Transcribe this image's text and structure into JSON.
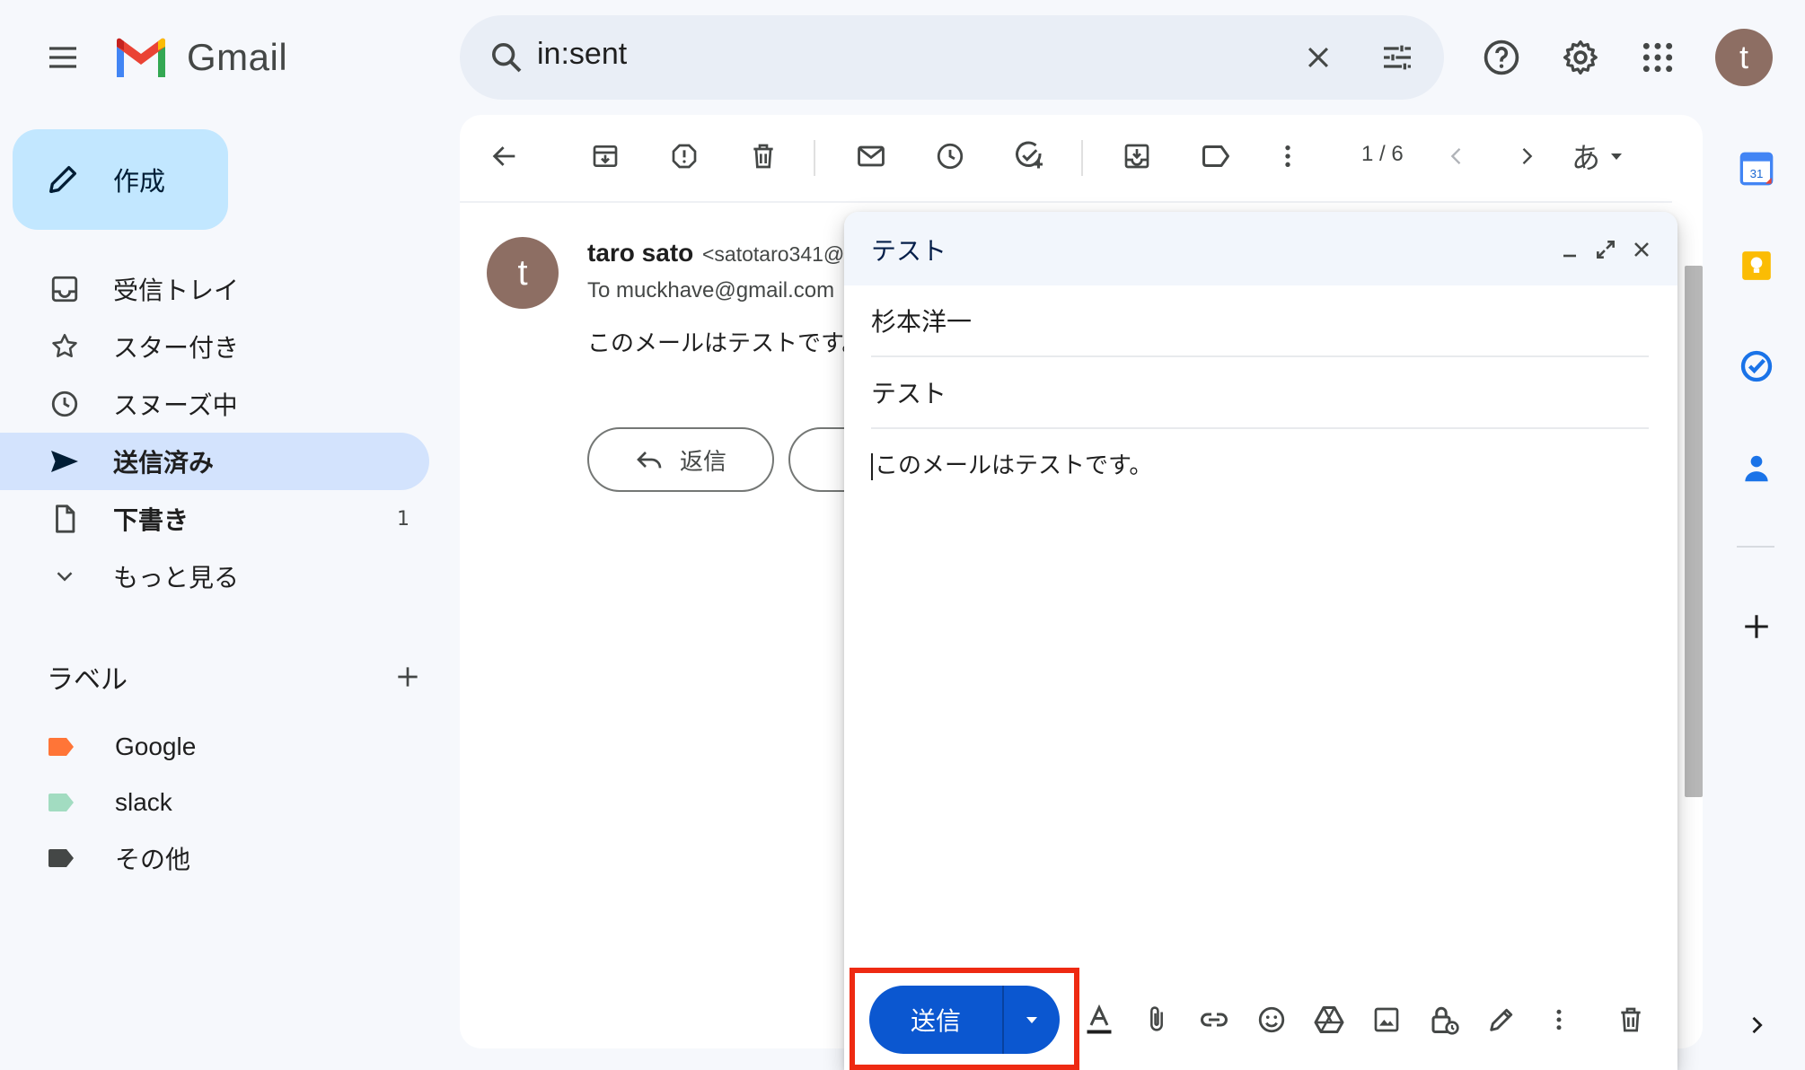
{
  "header": {
    "app_name": "Gmail",
    "search_value": "in:sent"
  },
  "sidebar": {
    "compose_label": "作成",
    "items": [
      {
        "label": "受信トレイ",
        "icon": "inbox-icon"
      },
      {
        "label": "スター付き",
        "icon": "star-icon"
      },
      {
        "label": "スヌーズ中",
        "icon": "clock-icon"
      },
      {
        "label": "送信済み",
        "icon": "send-icon",
        "active": true
      },
      {
        "label": "下書き",
        "icon": "draft-icon",
        "count": "1"
      },
      {
        "label": "もっと見る",
        "icon": "chevron-down-icon"
      }
    ],
    "labels_heading": "ラベル",
    "labels": [
      {
        "name": "Google",
        "color": "#ff7537"
      },
      {
        "name": "slack",
        "color": "#a2dcc1"
      },
      {
        "name": "その他",
        "color": "#444746"
      }
    ]
  },
  "toolbar": {
    "pager": "1 / 6",
    "input_tool": "あ"
  },
  "message": {
    "sender_avatar": "t",
    "sender_name": "taro sato",
    "sender_email": "<satotaro341@",
    "to_line": "To muckhave@gmail.com",
    "body": "このメールはテストです。",
    "reply_label": "返信"
  },
  "compose": {
    "title": "テスト",
    "recipient": "杉本洋一",
    "subject": "テスト",
    "body": "このメールはテストです。",
    "send_label": "送信"
  },
  "user_avatar": "t",
  "colors": {
    "accent": "#0b57d0",
    "highlight": "#ee2a12",
    "sidebar_active": "#d3e3fd",
    "compose_button": "#c2e7ff"
  }
}
